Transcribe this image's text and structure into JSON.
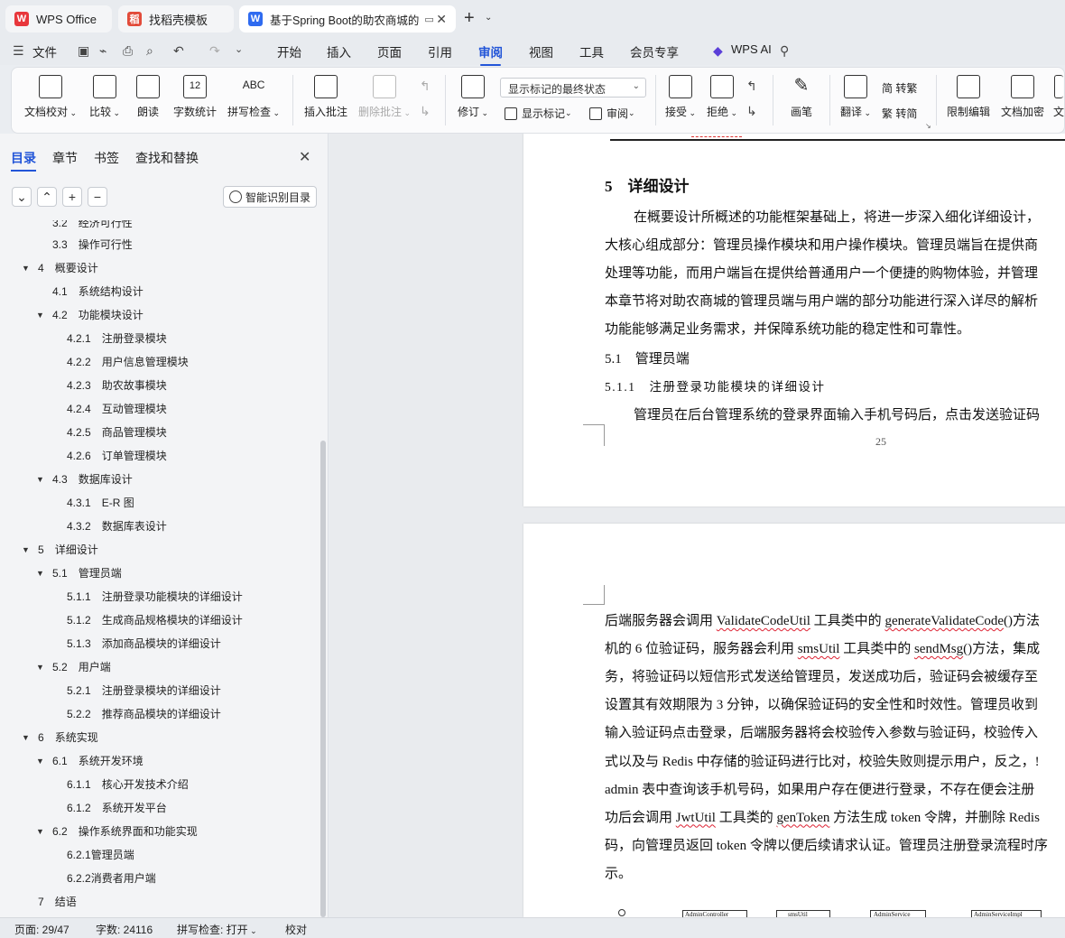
{
  "tabs": [
    {
      "label": "WPS Office",
      "logo": "W"
    },
    {
      "label": "找稻壳模板",
      "logo": "稻"
    },
    {
      "label": "基于Spring Boot的助农商城的",
      "logo": "W"
    }
  ],
  "menu": {
    "file": "文件",
    "items": [
      "开始",
      "插入",
      "页面",
      "引用",
      "审阅",
      "视图",
      "工具",
      "会员专享"
    ],
    "active": "审阅",
    "ai": "WPS AI"
  },
  "ribbon": {
    "doc_check": "文档校对",
    "compare": "比较",
    "read_aloud": "朗读",
    "word_count": "字数统计",
    "word_count_icon_text": "12",
    "spell_check": "拼写检查",
    "spell_icon_text": "ABC",
    "insert_comment": "插入批注",
    "delete_comment": "删除批注",
    "revise": "修订",
    "markup_state": "显示标记的最终状态",
    "show_markup": "显示标记",
    "review": "审阅",
    "accept": "接受",
    "reject": "拒绝",
    "pen": "画笔",
    "translate": "翻译",
    "to_traditional": "简 转繁",
    "to_simplified": "繁 转简",
    "restrict_edit": "限制编辑",
    "encrypt": "文档加密",
    "more": "文"
  },
  "left_panel": {
    "tabs": [
      "目录",
      "章节",
      "书签",
      "查找和替换"
    ],
    "active_tab": "目录",
    "smart_button": "智能识别目录",
    "toc": [
      {
        "num": "3.2",
        "text": "经济可行性",
        "level": 2,
        "toggle": ""
      },
      {
        "num": "3.3",
        "text": "操作可行性",
        "level": 2,
        "toggle": ""
      },
      {
        "num": "4",
        "text": "概要设计",
        "level": 1,
        "toggle": "▼"
      },
      {
        "num": "4.1",
        "text": "系统结构设计",
        "level": 2,
        "toggle": ""
      },
      {
        "num": "4.2",
        "text": "功能模块设计",
        "level": 2,
        "toggle": "▼"
      },
      {
        "num": "4.2.1",
        "text": "注册登录模块",
        "level": 3,
        "toggle": ""
      },
      {
        "num": "4.2.2",
        "text": "用户信息管理模块",
        "level": 3,
        "toggle": ""
      },
      {
        "num": "4.2.3",
        "text": "助农故事模块",
        "level": 3,
        "toggle": ""
      },
      {
        "num": "4.2.4",
        "text": "互动管理模块",
        "level": 3,
        "toggle": ""
      },
      {
        "num": "4.2.5",
        "text": "商品管理模块",
        "level": 3,
        "toggle": ""
      },
      {
        "num": "4.2.6",
        "text": "订单管理模块",
        "level": 3,
        "toggle": ""
      },
      {
        "num": "4.3",
        "text": "数据库设计",
        "level": 2,
        "toggle": "▼"
      },
      {
        "num": "4.3.1",
        "text": "E-R 图",
        "level": 3,
        "toggle": ""
      },
      {
        "num": "4.3.2",
        "text": "数据库表设计",
        "level": 3,
        "toggle": ""
      },
      {
        "num": "5",
        "text": "详细设计",
        "level": 1,
        "toggle": "▼"
      },
      {
        "num": "5.1",
        "text": "管理员端",
        "level": 2,
        "toggle": "▼"
      },
      {
        "num": "5.1.1",
        "text": "注册登录功能模块的详细设计",
        "level": 3,
        "toggle": ""
      },
      {
        "num": "5.1.2",
        "text": "生成商品规格模块的详细设计",
        "level": 3,
        "toggle": ""
      },
      {
        "num": "5.1.3",
        "text": "添加商品模块的详细设计",
        "level": 3,
        "toggle": ""
      },
      {
        "num": "5.2",
        "text": "用户端",
        "level": 2,
        "toggle": "▼"
      },
      {
        "num": "5.2.1",
        "text": "注册登录模块的详细设计",
        "level": 3,
        "toggle": ""
      },
      {
        "num": "5.2.2",
        "text": "推荐商品模块的详细设计",
        "level": 3,
        "toggle": ""
      },
      {
        "num": "6",
        "text": "系统实现",
        "level": 1,
        "toggle": "▼"
      },
      {
        "num": "6.1",
        "text": "系统开发环境",
        "level": 2,
        "toggle": "▼"
      },
      {
        "num": "6.1.1",
        "text": "核心开发技术介绍",
        "level": 3,
        "toggle": ""
      },
      {
        "num": "6.1.2",
        "text": "系统开发平台",
        "level": 3,
        "toggle": ""
      },
      {
        "num": "6.2",
        "text": "操作系统界面和功能实现",
        "level": 2,
        "toggle": "▼"
      },
      {
        "num": "6.2.1管理员端",
        "text": "",
        "level": 3,
        "toggle": ""
      },
      {
        "num": "6.2.2消费者用户端",
        "text": "",
        "level": 3,
        "toggle": ""
      },
      {
        "num": "7",
        "text": "结语",
        "level": 1,
        "toggle": ""
      }
    ]
  },
  "document": {
    "page1": {
      "heading": "5　详细设计",
      "paragraph": [
        "在概要设计所概述的功能框架基础上，将进一步深入细化详细设计，",
        "大核心组成部分：管理员操作模块和用户操作模块。管理员端旨在提供商",
        "处理等功能，而用户端旨在提供给普通用户一个便捷的购物体验，并管理",
        "本章节将对助农商城的管理员端与用户端的部分功能进行深入详尽的解析",
        "功能能够满足业务需求，并保障系统功能的稳定性和可靠性。"
      ],
      "sub_heading": "5.1　管理员端",
      "sub_sub_heading": "5.1.1　注册登录功能模块的详细设计",
      "last_line": "管理员在后台管理系统的登录界面输入手机号码后，点击发送验证码",
      "page_number": "25"
    },
    "page2": {
      "lines": [
        [
          "后端服务器会调用 ",
          "ValidateCodeUtil",
          " 工具类中的 ",
          "generateValidateCode",
          "()方法"
        ],
        [
          "机的 6 位验证码，服务器会利用 ",
          "smsUtil",
          " 工具类中的 ",
          "sendMsg",
          "()方法，集成"
        ],
        [
          "务，将验证码以短信形式发送给管理员，发送成功后，验证码会被缓存至"
        ],
        [
          "设置其有效期限为 3 分钟，以确保验证码的安全性和时效性。管理员收到"
        ],
        [
          "输入验证码点击登录，后端服务器将会校验传入参数与验证码，校验传入"
        ],
        [
          "式以及与 Redis 中存储的验证码进行比对，校验失败则提示用户，反之，!"
        ],
        [
          "admin 表中查询该手机号码，如果用户存在便进行登录，不存在便会注册"
        ],
        [
          "功后会调用 ",
          "JwtUtil",
          " 工具类的 ",
          "genToken",
          " 方法生成 token 令牌，并删除 Redis"
        ],
        [
          "码，向管理员返回 token 令牌以便后续请求认证。管理员注册登录流程时序"
        ],
        [
          "示。"
        ]
      ],
      "diagram_labels": [
        "AdminController",
        "smsUtil",
        "AdminService",
        "AdminServiceImpl"
      ]
    }
  },
  "status_bar": {
    "page": "页面: 29/47",
    "words": "字数: 24116",
    "spell": "拼写检查: 打开",
    "proof": "校对"
  },
  "colors": {
    "accent": "#2255d8",
    "wps_logo": "#e8373c",
    "docer_logo": "#e24b3a",
    "writer_logo": "#2f6bf0"
  }
}
